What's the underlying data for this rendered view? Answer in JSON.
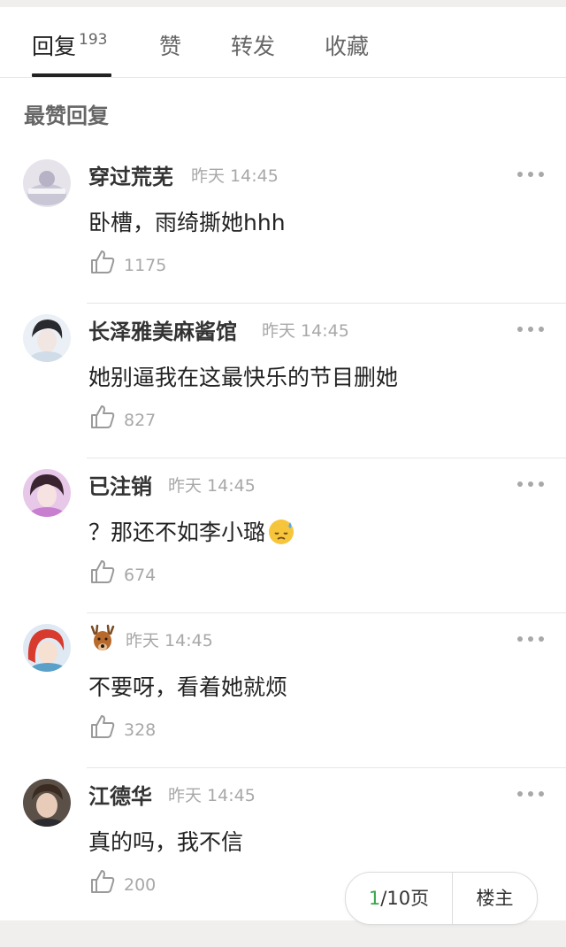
{
  "tabs": [
    {
      "label": "回复",
      "count": "193",
      "active": true
    },
    {
      "label": "赞"
    },
    {
      "label": "转发"
    },
    {
      "label": "收藏"
    }
  ],
  "section_title": "最赞回复",
  "comments": [
    {
      "username": "穿过荒芜",
      "time": "昨天 14:45",
      "content": "卧槽，雨绮撕她hhh",
      "likes": "1175",
      "avatar_icon": "avatar-photo"
    },
    {
      "username": "长泽雅美麻酱馆",
      "time": "昨天 14:45",
      "content": "她别逼我在这最快乐的节目删她",
      "likes": "827",
      "avatar_icon": "avatar-photo"
    },
    {
      "username": "已注销",
      "time": "昨天 14:45",
      "content": "？那还不如李小璐",
      "content_emoji": "sweat-face-emoji",
      "likes": "674",
      "avatar_icon": "avatar-photo"
    },
    {
      "username_emoji": "deer-emoji",
      "time": "昨天 14:45",
      "content": "不要呀，看着她就烦",
      "likes": "328",
      "avatar_icon": "avatar-cartoon"
    },
    {
      "username": "江德华",
      "time": "昨天 14:45",
      "content": "真的吗，我不信",
      "likes": "200",
      "avatar_icon": "avatar-photo"
    }
  ],
  "pager": {
    "current": "1",
    "total_label": "/10页",
    "op_label": "楼主"
  },
  "colors": {
    "accent_green": "#3aa64b",
    "muted_text": "#a8a8a8",
    "divider": "#e6e6e6"
  }
}
